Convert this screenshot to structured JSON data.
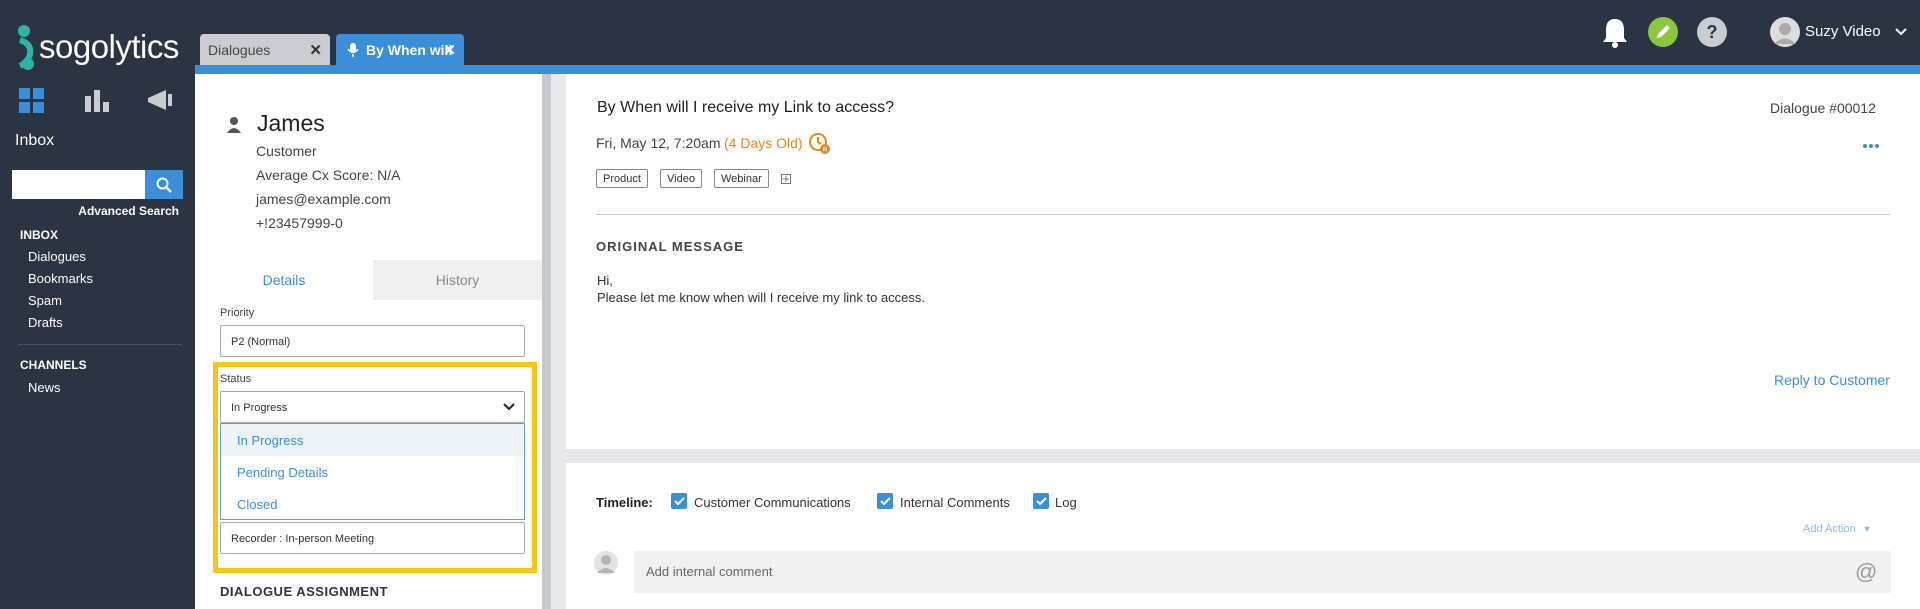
{
  "brand": {
    "name": "sogolytics"
  },
  "left_nav": {
    "title": "Inbox",
    "search": {
      "value": "",
      "placeholder": ""
    },
    "advanced_search": "Advanced Search",
    "sections": [
      {
        "title": "INBOX",
        "items": [
          "Dialogues",
          "Bookmarks",
          "Spam",
          "Drafts"
        ]
      },
      {
        "title": "CHANNELS",
        "items": [
          "News"
        ]
      }
    ]
  },
  "tabs": [
    {
      "label": "Dialogues",
      "active": false
    },
    {
      "label": "By When will",
      "active": true
    }
  ],
  "header": {
    "user_name": "Suzy Video"
  },
  "contact": {
    "name": "James",
    "role": "Customer",
    "cx_score": "Average Cx Score: N/A",
    "email": "james@example.com",
    "phone": "+!23457999-0"
  },
  "detail_tabs": {
    "details": "Details",
    "history": "History"
  },
  "fields": {
    "priority_label": "Priority",
    "priority_value": "P2 (Normal)",
    "status_label": "Status",
    "status_value": "In Progress",
    "status_options": [
      "In Progress",
      "Pending Details",
      "Closed"
    ],
    "recorder_value": "Recorder : In-person Meeting",
    "assignment_heading": "DIALOGUE ASSIGNMENT"
  },
  "dialogue": {
    "subject": "By When will I receive my Link to access?",
    "number": "Dialogue #00012",
    "date": "Fri, May 12, 7:20am",
    "age": "(4 Days Old)",
    "tags": [
      "Product",
      "Video",
      "Webinar"
    ],
    "original_heading": "ORIGINAL MESSAGE",
    "message_lines": [
      "Hi,",
      "Please let me know when will I receive my link to access."
    ],
    "reply_label": "Reply to Customer"
  },
  "timeline": {
    "label": "Timeline:",
    "filters": [
      {
        "label": "Customer Communications",
        "checked": true
      },
      {
        "label": "Internal Comments",
        "checked": true
      },
      {
        "label": "Log",
        "checked": true
      }
    ],
    "add_action": "Add Action",
    "comment_placeholder": "Add internal comment"
  },
  "colors": {
    "accent": "#3b8fd9",
    "nav_bg": "#2b3442",
    "highlight": "#f5c518",
    "age": "#e8861e"
  }
}
